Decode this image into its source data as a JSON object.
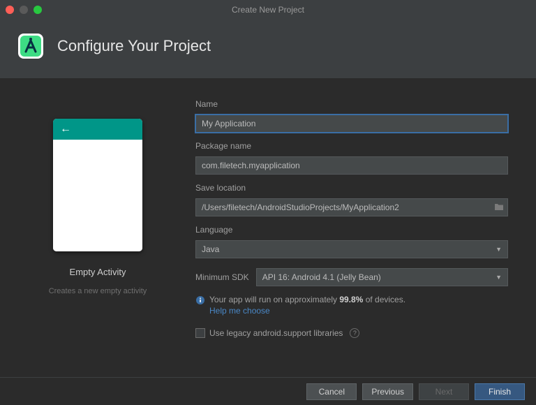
{
  "window": {
    "title": "Create New Project"
  },
  "header": {
    "title": "Configure Your Project"
  },
  "preview": {
    "template_name": "Empty Activity",
    "template_desc": "Creates a new empty activity"
  },
  "form": {
    "name_label": "Name",
    "name_value": "My Application",
    "package_label": "Package name",
    "package_value": "com.filetech.myapplication",
    "location_label": "Save location",
    "location_value": "/Users/filetech/AndroidStudioProjects/MyApplication2",
    "language_label": "Language",
    "language_value": "Java",
    "min_sdk_label": "Minimum SDK",
    "min_sdk_value": "API 16: Android 4.1 (Jelly Bean)",
    "info_prefix": "Your app will run on approximately ",
    "info_pct": "99.8%",
    "info_suffix": " of devices.",
    "help_link": "Help me choose",
    "legacy_label": "Use legacy android.support libraries"
  },
  "footer": {
    "cancel": "Cancel",
    "previous": "Previous",
    "next": "Next",
    "finish": "Finish"
  }
}
